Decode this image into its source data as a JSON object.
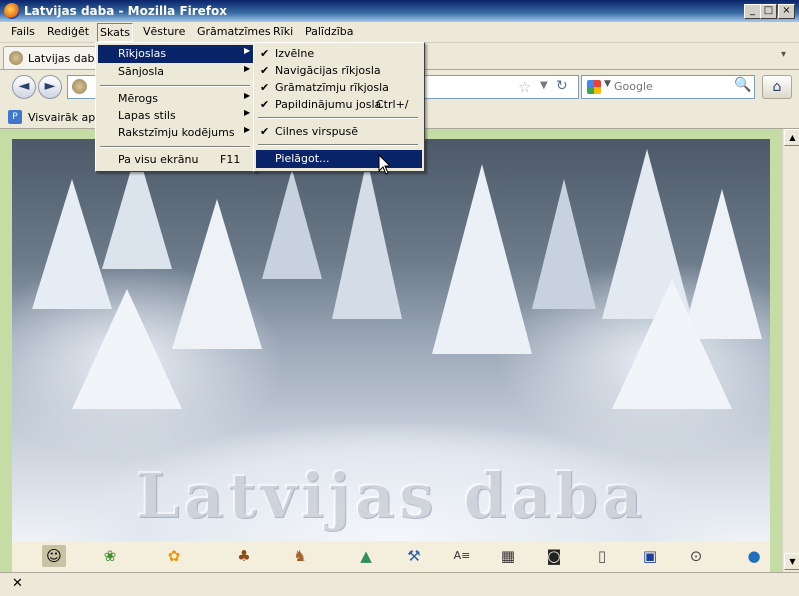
{
  "window": {
    "title": "Latvijas daba - Mozilla Firefox",
    "controls": {
      "minimize": "_",
      "maximize": "□",
      "close": "×"
    }
  },
  "menubar": {
    "items": [
      "Fails",
      "Rediģēt",
      "Skats",
      "Vēsture",
      "Grāmatzīmes",
      "Rīki",
      "Palīdzība"
    ],
    "open_index": 2
  },
  "tabs": [
    {
      "label": "Latvijas daba",
      "icon": "page-icon"
    }
  ],
  "tabstrip": {
    "list_all": "▾"
  },
  "navbar": {
    "back": "◄",
    "forward": "►",
    "reload": "↻",
    "bookmark_star": "☆",
    "dropdown": "▼",
    "search_placeholder": "Google",
    "search_engine_dropdown": "▼",
    "search_button": "🔍",
    "home": "⌂"
  },
  "bookmarks": {
    "items": [
      {
        "label": "Visvairāk apm",
        "icon": "page-icon"
      }
    ]
  },
  "skats_menu": {
    "items": [
      {
        "label": "Rīkjoslas",
        "submenu": true,
        "highlighted": true
      },
      {
        "label": "Sānjosla",
        "submenu": true
      },
      {
        "label": "Mērogs",
        "submenu": true
      },
      {
        "label": "Lapas stils",
        "submenu": true
      },
      {
        "label": "Rakstzīmju kodējums",
        "submenu": true
      },
      {
        "label": "Pa visu ekrānu",
        "shortcut": "F11"
      }
    ],
    "submenu_arrow": "▶"
  },
  "rikjoslas_submenu": {
    "items": [
      {
        "label": "Izvēlne",
        "checked": true
      },
      {
        "label": "Navigācijas rīkjosla",
        "checked": true
      },
      {
        "label": "Grāmatzīmju rīkjosla",
        "checked": true
      },
      {
        "label": "Papildinājumu josla",
        "checked": true,
        "shortcut": "Ctrl+/"
      },
      {
        "label": "Cilnes virspusē",
        "checked": true
      },
      {
        "label": "Pielāgot...",
        "checked": false,
        "highlighted": true
      }
    ],
    "check_mark": "✔"
  },
  "content": {
    "watermark": "Latvijas daba",
    "icon_strip": [
      "head-icon",
      "frog-icon",
      "flower-icon",
      "mushroom-icon",
      "deer-icon",
      "map-icon",
      "axe-icon",
      "letters-icon",
      "document-icon",
      "camera-icon",
      "book-icon",
      "info-icon",
      "search-icon",
      "globe-icon"
    ],
    "scrollbar": {
      "up": "▲",
      "down": "▼"
    }
  },
  "statusbar": {
    "close": "✕"
  }
}
